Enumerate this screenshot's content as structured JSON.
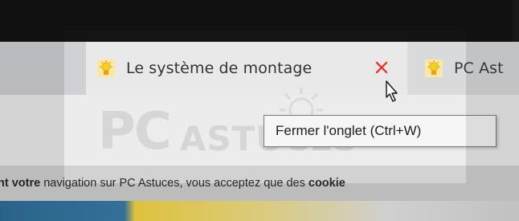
{
  "tabs": [
    {
      "title": "Le système de montage",
      "active": true,
      "favicon": "pc-astuces-sun-icon"
    },
    {
      "title": "PC Ast",
      "active": false,
      "favicon": "pc-astuces-sun-icon"
    }
  ],
  "close_tab_icon": "close-x-icon",
  "tooltip": {
    "text": "Fermer l'onglet (Ctrl+W)"
  },
  "watermark": {
    "part1": "PC",
    "part2": "ASTUCES"
  },
  "cookie_banner": {
    "prefix": "nt votre",
    "middle": " navigation sur PC Astuces, vous acceptez que des ",
    "suffix": "cookie"
  },
  "colors": {
    "close_x": "#e53935",
    "favicon_yellow": "#f5d020",
    "favicon_orange": "#f29b1d"
  }
}
